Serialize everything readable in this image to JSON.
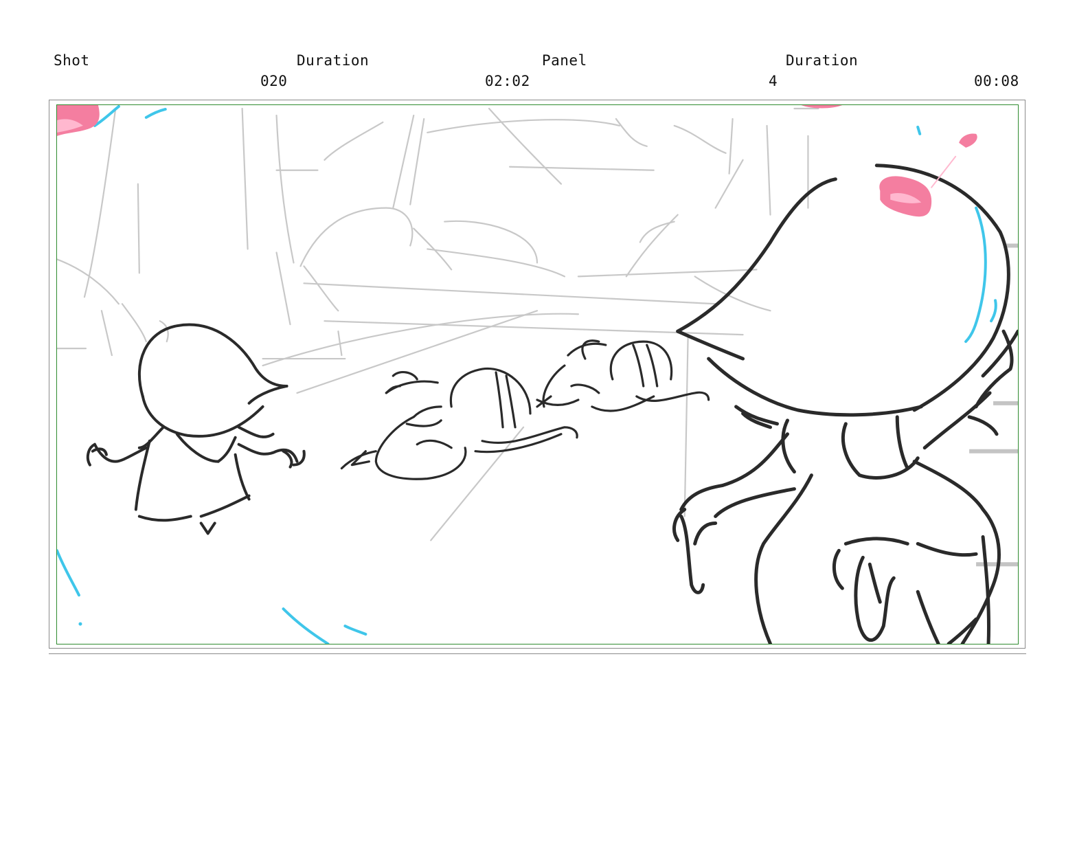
{
  "header": {
    "shot_label": "Shot",
    "duration_label": "Duration",
    "panel_label": "Panel",
    "panel_duration_label": "Duration",
    "shot_value": "020",
    "shot_duration_value": "02:02",
    "panel_value": "4",
    "panel_duration_value": "00:08"
  },
  "colors": {
    "frame_border": "#2e8b2e",
    "sketch_line": "#2a2a2a",
    "background_line": "#c8c8c8",
    "accent_blue": "#3fc6ea",
    "accent_pink": "#f47ea0"
  }
}
